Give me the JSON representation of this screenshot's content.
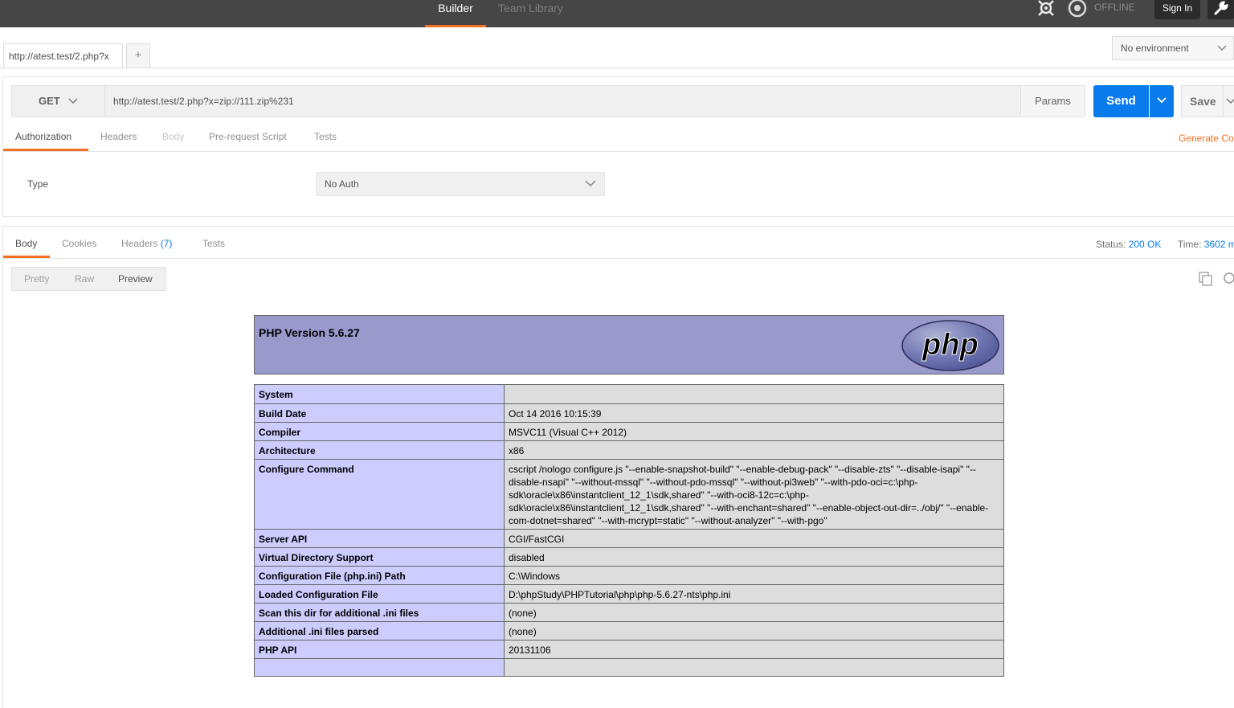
{
  "topbar": {
    "nav": {
      "builder": "Builder",
      "team_library": "Team Library"
    },
    "offline_label": "OFFLINE",
    "sign_in_label": "Sign In"
  },
  "tabs": {
    "items": [
      {
        "label": "http://atest.test/2.php?x"
      }
    ],
    "add_label": "+"
  },
  "environment": {
    "selected": "No environment"
  },
  "request": {
    "method": "GET",
    "url": "http://atest.test/2.php?x=zip://111.zip%231",
    "params_label": "Params",
    "send_label": "Send",
    "save_label": "Save",
    "tabs": [
      "Authorization",
      "Headers",
      "Body",
      "Pre-request Script",
      "Tests"
    ],
    "generate_code_label": "Generate Co",
    "auth": {
      "type_label": "Type",
      "selected": "No Auth"
    }
  },
  "response": {
    "tabs": {
      "body": "Body",
      "cookies": "Cookies",
      "headers": "Headers",
      "headers_count": "(7)",
      "tests": "Tests"
    },
    "status_label": "Status:",
    "status_value": "200 OK",
    "time_label": "Time:",
    "time_value": "3602 m",
    "view_modes": [
      "Pretty",
      "Raw",
      "Preview"
    ]
  },
  "preview": {
    "title": "PHP Version 5.6.27",
    "logo_text": "php",
    "rows": [
      {
        "key": "System",
        "value": ""
      },
      {
        "key": "Build Date",
        "value": "Oct 14 2016 10:15:39"
      },
      {
        "key": "Compiler",
        "value": "MSVC11 (Visual C++ 2012)"
      },
      {
        "key": "Architecture",
        "value": "x86"
      },
      {
        "key": "Configure Command",
        "value": "cscript /nologo configure.js \"--enable-snapshot-build\" \"--enable-debug-pack\" \"--disable-zts\" \"--disable-isapi\" \"--disable-nsapi\" \"--without-mssql\" \"--without-pdo-mssql\" \"--without-pi3web\" \"--with-pdo-oci=c:\\php-sdk\\oracle\\x86\\instantclient_12_1\\sdk,shared\" \"--with-oci8-12c=c:\\php-sdk\\oracle\\x86\\instantclient_12_1\\sdk,shared\" \"--with-enchant=shared\" \"--enable-object-out-dir=../obj/\" \"--enable-com-dotnet=shared\" \"--with-mcrypt=static\" \"--without-analyzer\" \"--with-pgo\""
      },
      {
        "key": "Server API",
        "value": "CGI/FastCGI"
      },
      {
        "key": "Virtual Directory Support",
        "value": "disabled"
      },
      {
        "key": "Configuration File (php.ini) Path",
        "value": "C:\\Windows"
      },
      {
        "key": "Loaded Configuration File",
        "value": "D:\\phpStudy\\PHPTutorial\\php\\php-5.6.27-nts\\php.ini"
      },
      {
        "key": "Scan this dir for additional .ini files",
        "value": "(none)"
      },
      {
        "key": "Additional .ini files parsed",
        "value": "(none)"
      },
      {
        "key": "PHP API",
        "value": "20131106"
      },
      {
        "key": "",
        "value": ""
      }
    ]
  },
  "colors": {
    "accent": "#f47023",
    "send_blue": "#097bed",
    "php_header": "#9999cc",
    "php_key_cell": "#ccccff",
    "php_value_cell": "#dddddd"
  }
}
